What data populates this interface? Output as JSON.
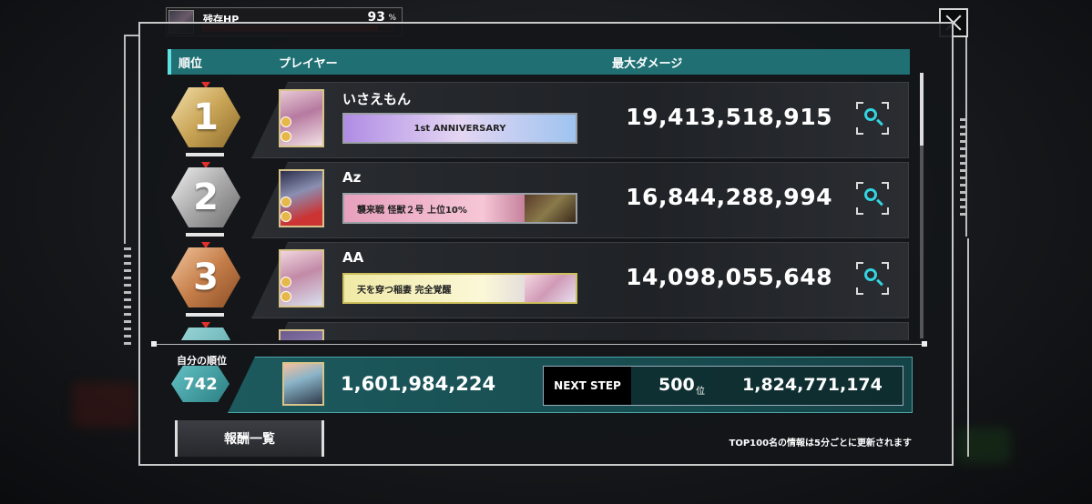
{
  "boss_hp": {
    "label": "残存HP",
    "value": "93",
    "unit": "%",
    "fraction": 0.93
  },
  "header": {
    "rank": "順位",
    "player": "プレイヤー",
    "damage": "最大ダメージ"
  },
  "rows": [
    {
      "rank": "1",
      "name": "いさえもん",
      "title": "1st ANNIVERSARY",
      "damage": "19,413,518,915"
    },
    {
      "rank": "2",
      "name": "Az",
      "title": "襲来戦 怪獣２号 上位10%",
      "damage": "16,844,288,994"
    },
    {
      "rank": "3",
      "name": "AA",
      "title": "天を穿つ稲妻 完全覚醒",
      "damage": "14,098,055,648"
    }
  ],
  "me": {
    "label": "自分の順位",
    "rank": "742",
    "damage": "1,601,984,224",
    "next_label": "NEXT STEP",
    "next_rank": "500",
    "next_rank_unit": "位",
    "next_damage": "1,824,771,174"
  },
  "footer": {
    "reward_button": "報酬一覧",
    "update_note": "TOP100名の情報は5分ごとに更新されます"
  }
}
